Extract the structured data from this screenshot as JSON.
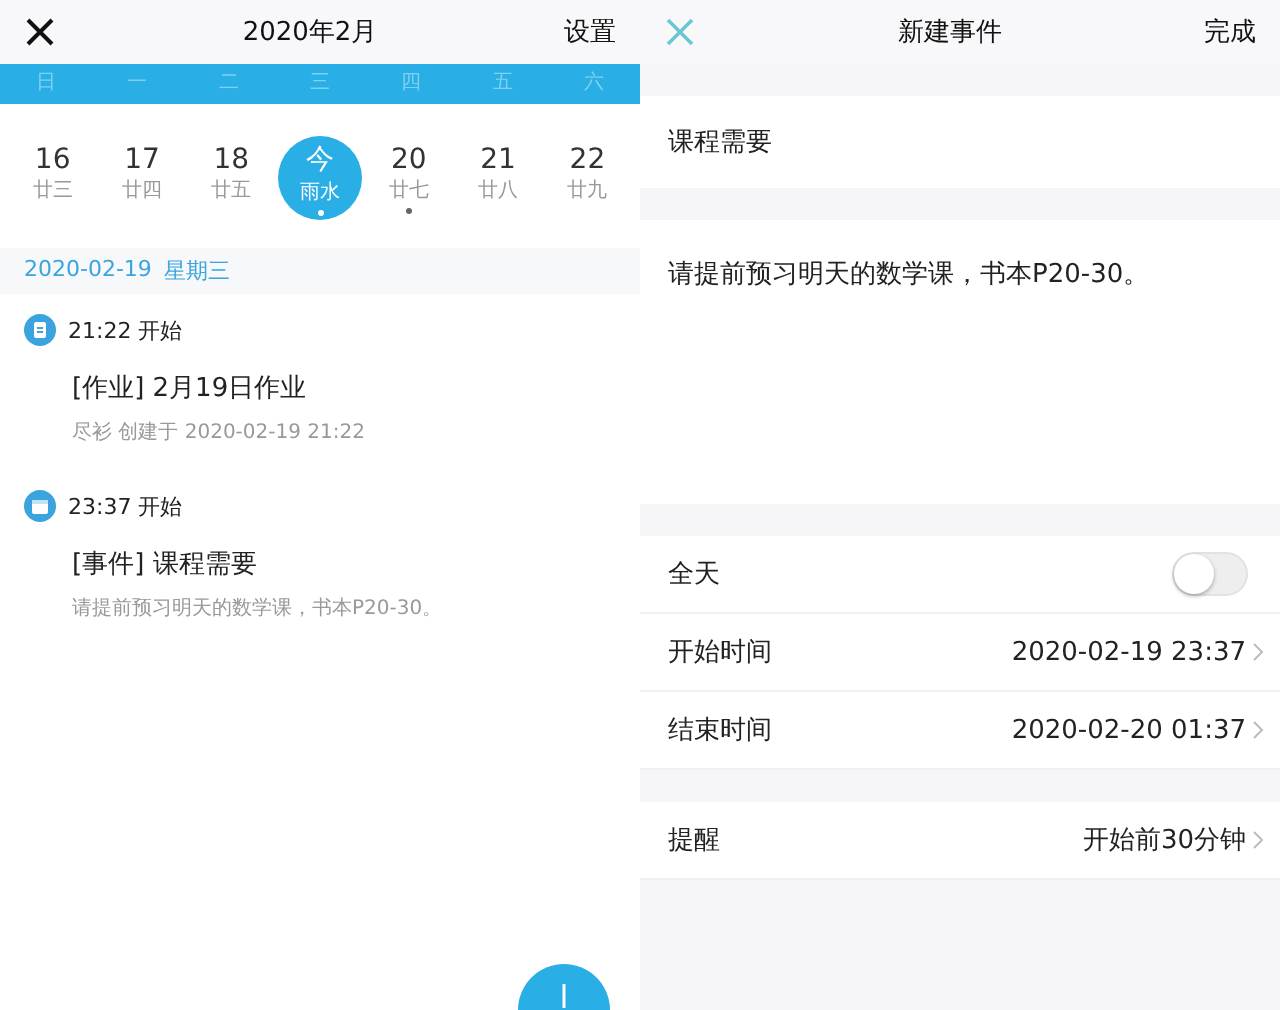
{
  "calendar": {
    "title": "2020年2月",
    "settings": "设置",
    "weekdays": [
      "日",
      "一",
      "二",
      "三",
      "四",
      "五",
      "六"
    ],
    "days": [
      {
        "day": "16",
        "lunar": "廿三",
        "selected": false,
        "has_event": false
      },
      {
        "day": "17",
        "lunar": "廿四",
        "selected": false,
        "has_event": false
      },
      {
        "day": "18",
        "lunar": "廿五",
        "selected": false,
        "has_event": false
      },
      {
        "day": "今",
        "lunar": "雨水",
        "selected": true,
        "has_event": true
      },
      {
        "day": "20",
        "lunar": "廿七",
        "selected": false,
        "has_event": true
      },
      {
        "day": "21",
        "lunar": "廿八",
        "selected": false,
        "has_event": false
      },
      {
        "day": "22",
        "lunar": "廿九",
        "selected": false,
        "has_event": false
      }
    ],
    "date_heading": {
      "date": "2020-02-19",
      "weekday": "星期三"
    },
    "entries": [
      {
        "kind": "homework",
        "start": "21:22 开始",
        "title": "[作业] 2月19日作业",
        "detail": "尽衫  创建于 2020-02-19 21:22"
      },
      {
        "kind": "event",
        "start": "23:37 开始",
        "title": "[事件] 课程需要",
        "detail": "请提前预习明天的数学课，书本P20-30。"
      }
    ]
  },
  "new_event": {
    "title": "新建事件",
    "done": "完成",
    "name_value": "课程需要",
    "notes_value": "请提前预习明天的数学课，书本P20-30。",
    "all_day": {
      "label": "全天",
      "on": false
    },
    "rows": [
      {
        "label": "开始时间",
        "value": "2020-02-19 23:37"
      },
      {
        "label": "结束时间",
        "value": "2020-02-20 01:37"
      }
    ],
    "reminder": {
      "label": "提醒",
      "value": "开始前30分钟"
    }
  }
}
